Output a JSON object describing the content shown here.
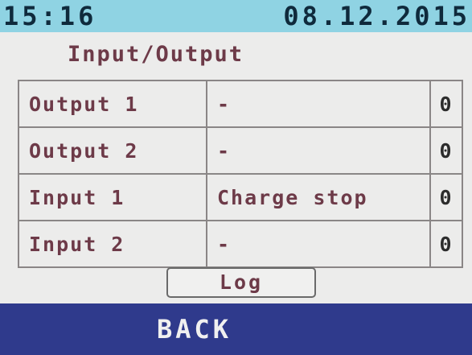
{
  "status_bar": {
    "time": "15:16",
    "date": "08.12.2015"
  },
  "page": {
    "title": "Input/Output"
  },
  "io_rows": [
    {
      "name": "Output 1",
      "state": "-",
      "count": "0"
    },
    {
      "name": "Output 2",
      "state": "-",
      "count": "0"
    },
    {
      "name": "Input 1",
      "state": "Charge stop",
      "count": "0"
    },
    {
      "name": "Input 2",
      "state": "-",
      "count": "0"
    }
  ],
  "buttons": {
    "log_label": "Log",
    "back_label": "BACK"
  },
  "colors": {
    "status_bar_bg": "#8fd3e3",
    "label_text": "#6d3a48",
    "back_bar_bg": "#2f3a8c"
  }
}
